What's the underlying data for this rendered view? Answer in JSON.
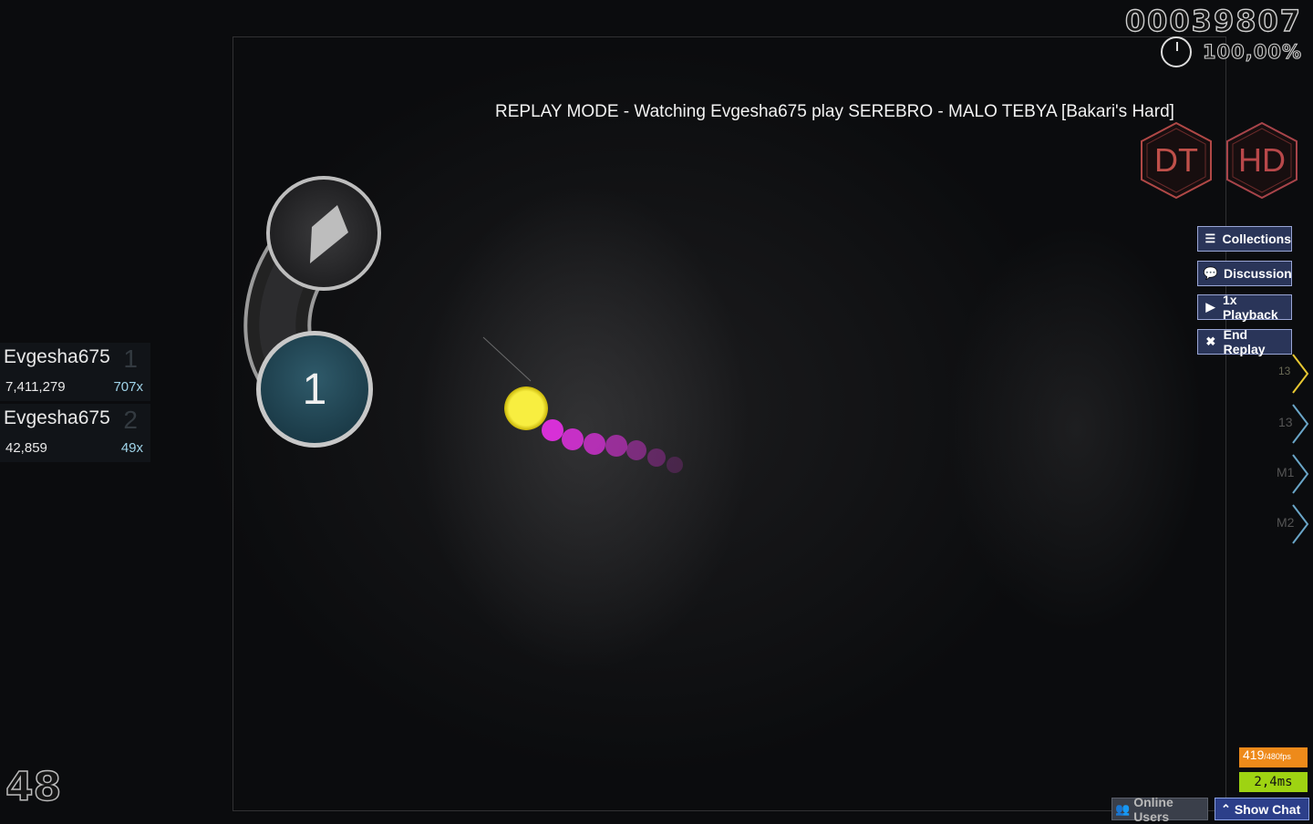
{
  "hud": {
    "score": "00039807",
    "accuracy": "100,00%",
    "combo": "48"
  },
  "replay_banner": "REPLAY MODE - Watching Evgesha675 play SEREBRO - MALO TEBYA [Bakari's Hard]",
  "mods": [
    {
      "label": "DT",
      "color": "#c0504a"
    },
    {
      "label": "HD",
      "color": "#b8484a"
    }
  ],
  "side_buttons": {
    "collections": "Collections",
    "discussion": "Discussion",
    "playback": "1x Playback",
    "end_replay": "End Replay"
  },
  "key_overlay": {
    "k1": "13",
    "k2": "13",
    "m1": "M1",
    "m2": "M2"
  },
  "leaderboard": [
    {
      "name": "Evgesha675",
      "rank": "1",
      "score": "7,411,279",
      "combo": "707x"
    },
    {
      "name": "Evgesha675",
      "rank": "2",
      "score": "42,859",
      "combo": "49x"
    }
  ],
  "hit_circle": {
    "number": "1"
  },
  "perf": {
    "fps": "419",
    "fps_max": "/480fps",
    "frame_time": "2,4ms"
  },
  "bottom_bar": {
    "online_users": "Online Users",
    "show_chat": "Show Chat"
  },
  "colors": {
    "cursor": "#f2e11a",
    "cursor_trail": "#e030e0",
    "button_bg": "#2a3559",
    "fps_bg": "#ee8a1a",
    "ms_bg": "#9ed312"
  }
}
